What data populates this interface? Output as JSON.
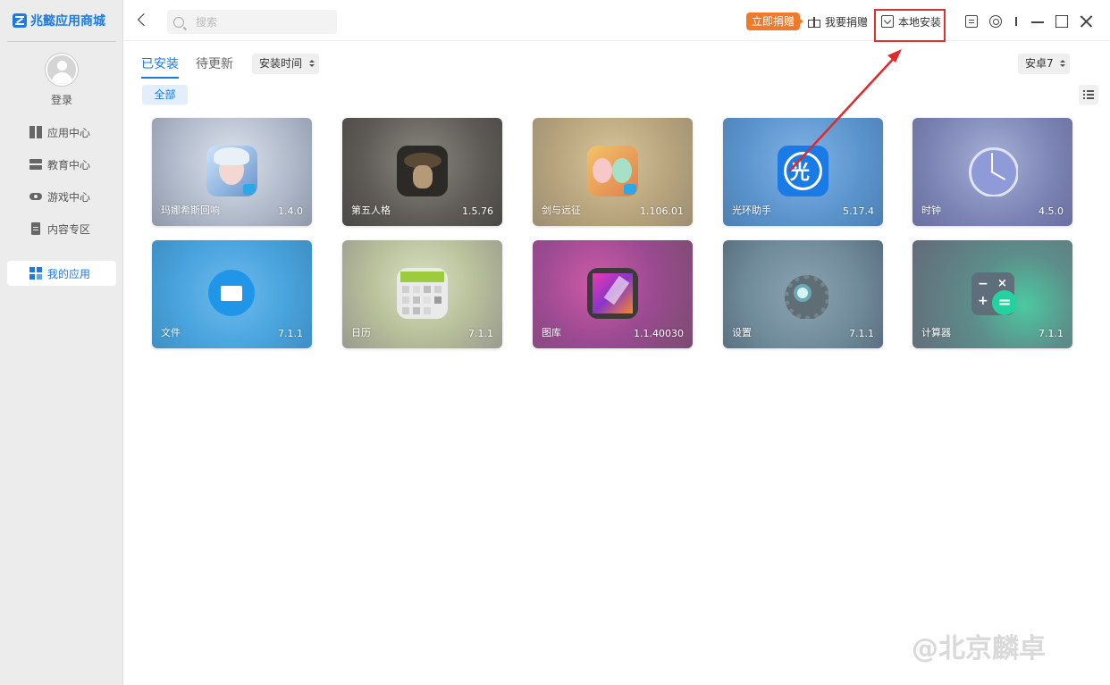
{
  "sidebar": {
    "brand": "兆懿应用商城",
    "login": "登录",
    "items": [
      {
        "label": "应用中心"
      },
      {
        "label": "教育中心"
      },
      {
        "label": "游戏中心"
      },
      {
        "label": "内容专区"
      },
      {
        "label": "我的应用"
      }
    ]
  },
  "topbar": {
    "search_placeholder": "搜索",
    "donate_now": "立即捐赠",
    "donate": "我要捐赠",
    "local_install": "本地安装"
  },
  "content": {
    "tabs": [
      {
        "label": "已安装"
      },
      {
        "label": "待更新"
      }
    ],
    "sort": "安装时间",
    "android_version": "安卓7",
    "filter_all": "全部",
    "apps": [
      {
        "name": "玛娜希斯回响",
        "version": "1.4.0"
      },
      {
        "name": "第五人格",
        "version": "1.5.76"
      },
      {
        "name": "剑与远征",
        "version": "1.106.01"
      },
      {
        "name": "光环助手",
        "version": "5.17.4"
      },
      {
        "name": "时钟",
        "version": "4.5.0"
      },
      {
        "name": "文件",
        "version": "7.1.1"
      },
      {
        "name": "日历",
        "version": "7.1.1"
      },
      {
        "name": "图库",
        "version": "1.1.40030"
      },
      {
        "name": "设置",
        "version": "7.1.1"
      },
      {
        "name": "计算器",
        "version": "7.1.1"
      }
    ]
  },
  "watermark": "@北京麟卓",
  "colors": {
    "accent": "#1f7ae0",
    "donate": "#f07a2a",
    "highlight": "#e03030"
  }
}
